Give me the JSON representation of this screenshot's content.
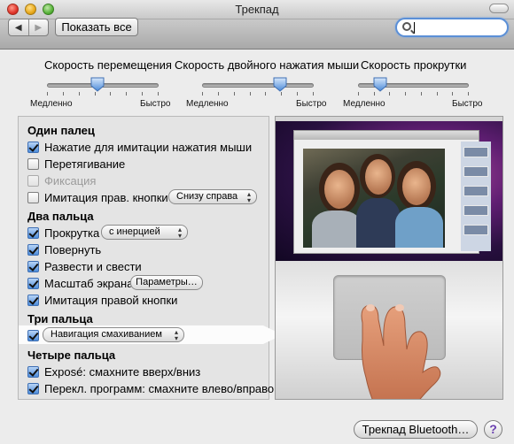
{
  "window": {
    "title": "Трекпад"
  },
  "toolbar": {
    "back_glyph": "◀",
    "forward_glyph": "▶",
    "show_all_label": "Показать все",
    "search": {
      "value": "",
      "placeholder": ""
    }
  },
  "sliders": [
    {
      "title": "Скорость перемещения",
      "slow": "Медленно",
      "fast": "Быстро",
      "value_fraction": 0.45
    },
    {
      "title": "Скорость двойного нажатия мыши",
      "slow": "Медленно",
      "fast": "Быстро",
      "value_fraction": 0.7
    },
    {
      "title": "Скорость прокрутки",
      "slow": "Медленно",
      "fast": "Быстро",
      "value_fraction": 0.2
    }
  ],
  "one_finger": {
    "heading": "Один палец",
    "tap_to_click": {
      "label": "Нажатие для имитации нажатия мыши",
      "checked": true
    },
    "dragging": {
      "label": "Перетягивание",
      "checked": false
    },
    "drag_lock": {
      "label": "Фиксация",
      "checked": false,
      "disabled": true
    },
    "secondary_click": {
      "label": "Имитация прав. кнопки",
      "checked": false,
      "popup": "Снизу справа"
    }
  },
  "two_fingers": {
    "heading": "Два пальца",
    "scroll": {
      "label": "Прокрутка",
      "checked": true,
      "popup": "с инерцией"
    },
    "rotate": {
      "label": "Повернуть",
      "checked": true
    },
    "pinch": {
      "label": "Развести и свести",
      "checked": true
    },
    "zoom": {
      "label": "Масштаб экрана",
      "checked": true,
      "button": "Параметры…"
    },
    "secondary": {
      "label": "Имитация правой кнопки",
      "checked": true
    }
  },
  "three_fingers": {
    "heading": "Три пальца",
    "swipe": {
      "checked": true,
      "popup": "Навигация смахиванием"
    }
  },
  "four_fingers": {
    "heading": "Четыре пальца",
    "expose": {
      "label": "Exposé: смахните вверх/вниз",
      "checked": true
    },
    "switch_apps": {
      "label": "Перекл. программ: смахните влево/вправо",
      "checked": true
    }
  },
  "footer": {
    "bluetooth_button": "Трекпад Bluetooth…",
    "help_label": "?"
  },
  "colors": {
    "accent": "#4d8ddb",
    "search_focus": "#5b8fd6",
    "desktop": "#5f1e72"
  }
}
